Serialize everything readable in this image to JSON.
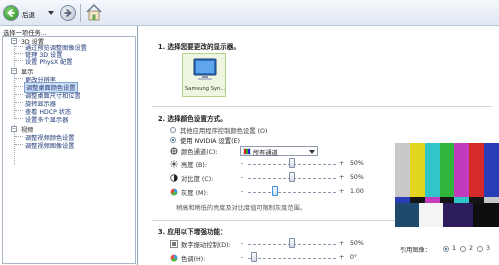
{
  "toolbar": {
    "back_label": "后退"
  },
  "left": {
    "task_label": "选择一项任务...",
    "tree": [
      {
        "label": "3D 设置",
        "level": 0,
        "category": true
      },
      {
        "label": "通过预览调整图像设置",
        "level": 1
      },
      {
        "label": "管理 3D 设置",
        "level": 1
      },
      {
        "label": "设置 PhysX 配置",
        "level": 1
      },
      {
        "label": "显示",
        "level": 0,
        "category": true
      },
      {
        "label": "更改分辨率",
        "level": 1
      },
      {
        "label": "调整桌面颜色设置",
        "level": 1,
        "selected": true
      },
      {
        "label": "调整桌面尺寸和位置",
        "level": 1
      },
      {
        "label": "旋转显示器",
        "level": 1
      },
      {
        "label": "查看 HDCP 状态",
        "level": 1
      },
      {
        "label": "设置多个显示器",
        "level": 1
      },
      {
        "label": "视频",
        "level": 0,
        "category": true
      },
      {
        "label": "调整视频颜色设置",
        "level": 1
      },
      {
        "label": "调整视频图像设置",
        "level": 1
      }
    ]
  },
  "main": {
    "step1": "1. 选择您要更改的显示器。",
    "monitor_name": "Samsung Syn...",
    "step2": "2. 选择颜色设置方式。",
    "radio_other": "其他应用程序控制颜色设置 (O)",
    "radio_nvidia": "使用 NVIDIA 设置(E)",
    "channel_label": "颜色通道(C):",
    "channel_value": "所有通道",
    "brightness_label": "亮度 (B):",
    "brightness_value": "50%",
    "contrast_label": "对比度 (C):",
    "contrast_value": "50%",
    "gamma_label": "灰度 (M):",
    "gamma_value": "1.00",
    "note": "稍高和稍低的亮度及对比度值可限制灰度范围。",
    "step3": "3. 应用以下增强功能：",
    "vibrance_label": "数字振动控制(D):",
    "vibrance_value": "50%",
    "hue_label": "色调(H):",
    "hue_value": "0°",
    "ref_label": "引用图像：",
    "ref_options": [
      "1",
      "2",
      "3"
    ],
    "minus": "-",
    "plus": "+"
  },
  "colors": {
    "bars_top": [
      "#c8c8c8",
      "#e2d61f",
      "#31c4c9",
      "#2fb53a",
      "#c33bbd",
      "#d62a2a",
      "#2a3db9"
    ],
    "bars_mid": [
      "#2a3db9",
      "#151515",
      "#c33bbd",
      "#151515",
      "#31c4c9",
      "#151515",
      "#c8c8c8"
    ]
  }
}
